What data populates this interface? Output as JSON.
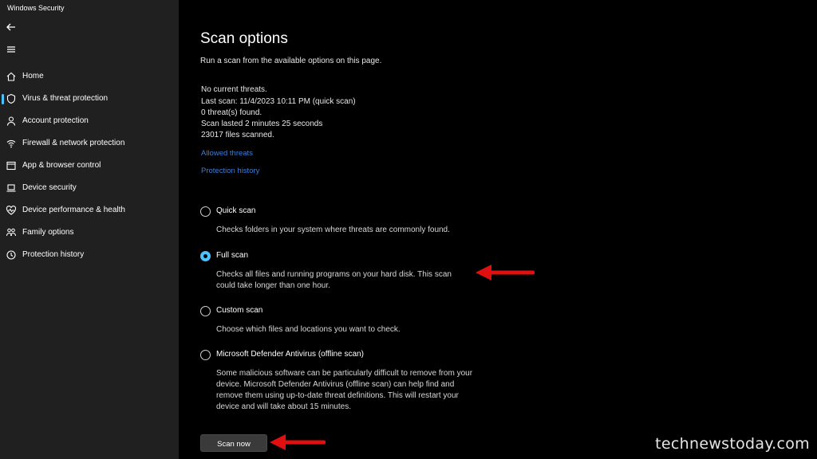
{
  "window": {
    "title": "Windows Security"
  },
  "sidebar": {
    "items": [
      {
        "label": "Home",
        "icon": "home-icon"
      },
      {
        "label": "Virus & threat protection",
        "icon": "shield-icon",
        "active": true
      },
      {
        "label": "Account protection",
        "icon": "person-icon"
      },
      {
        "label": "Firewall & network protection",
        "icon": "wifi-icon"
      },
      {
        "label": "App & browser control",
        "icon": "app-window-icon"
      },
      {
        "label": "Device security",
        "icon": "laptop-icon"
      },
      {
        "label": "Device performance & health",
        "icon": "heart-pulse-icon"
      },
      {
        "label": "Family options",
        "icon": "family-icon"
      },
      {
        "label": "Protection history",
        "icon": "history-icon"
      }
    ]
  },
  "main": {
    "title": "Scan options",
    "subtitle": "Run a scan from the available options on this page.",
    "status": [
      "No current threats.",
      "Last scan: 11/4/2023 10:11 PM (quick scan)",
      "0 threat(s) found.",
      "Scan lasted 2 minutes 25 seconds",
      "23017 files scanned."
    ],
    "links": {
      "allowed_threats": "Allowed threats",
      "protection_history": "Protection history"
    },
    "options": [
      {
        "label": "Quick scan",
        "desc": "Checks folders in your system where threats are commonly found.",
        "selected": false
      },
      {
        "label": "Full scan",
        "desc": "Checks all files and running programs on your hard disk. This scan could take longer than one hour.",
        "selected": true
      },
      {
        "label": "Custom scan",
        "desc": "Choose which files and locations you want to check.",
        "selected": false
      },
      {
        "label": "Microsoft Defender Antivirus (offline scan)",
        "desc": "Some malicious software can be particularly difficult to remove from your device. Microsoft Defender Antivirus (offline scan) can help find and remove them using up-to-date threat definitions. This will restart your device and will take about 15 minutes.",
        "selected": false
      }
    ],
    "scan_button": "Scan now"
  },
  "watermark": "technewstoday.com",
  "colors": {
    "accent": "#4cc2ff",
    "link": "#3d7fd6",
    "annotation_arrow": "#e01010",
    "sidebar_bg": "#202020"
  }
}
